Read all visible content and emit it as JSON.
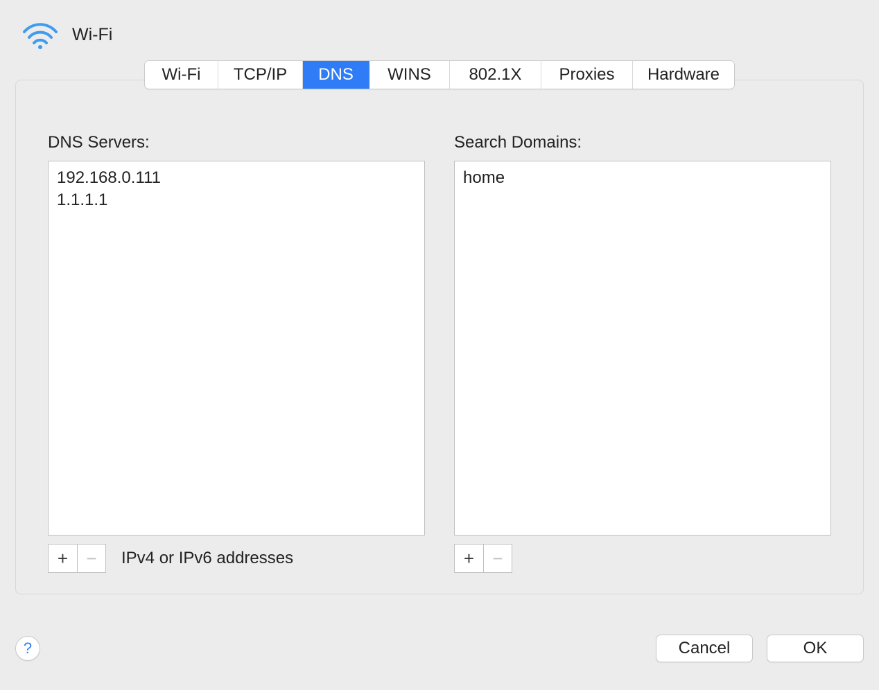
{
  "header": {
    "title": "Wi-Fi"
  },
  "tabs": {
    "wifi": "Wi-Fi",
    "tcpip": "TCP/IP",
    "dns": "DNS",
    "wins": "WINS",
    "x8021": "802.1X",
    "proxies": "Proxies",
    "hardware": "Hardware"
  },
  "dns": {
    "label": "DNS Servers:",
    "servers": [
      "192.168.0.111",
      "1.1.1.1"
    ],
    "hint": "IPv4 or IPv6 addresses"
  },
  "search": {
    "label": "Search Domains:",
    "domains": [
      "home"
    ]
  },
  "buttons": {
    "plus": "+",
    "minus": "−",
    "help": "?",
    "cancel": "Cancel",
    "ok": "OK"
  }
}
